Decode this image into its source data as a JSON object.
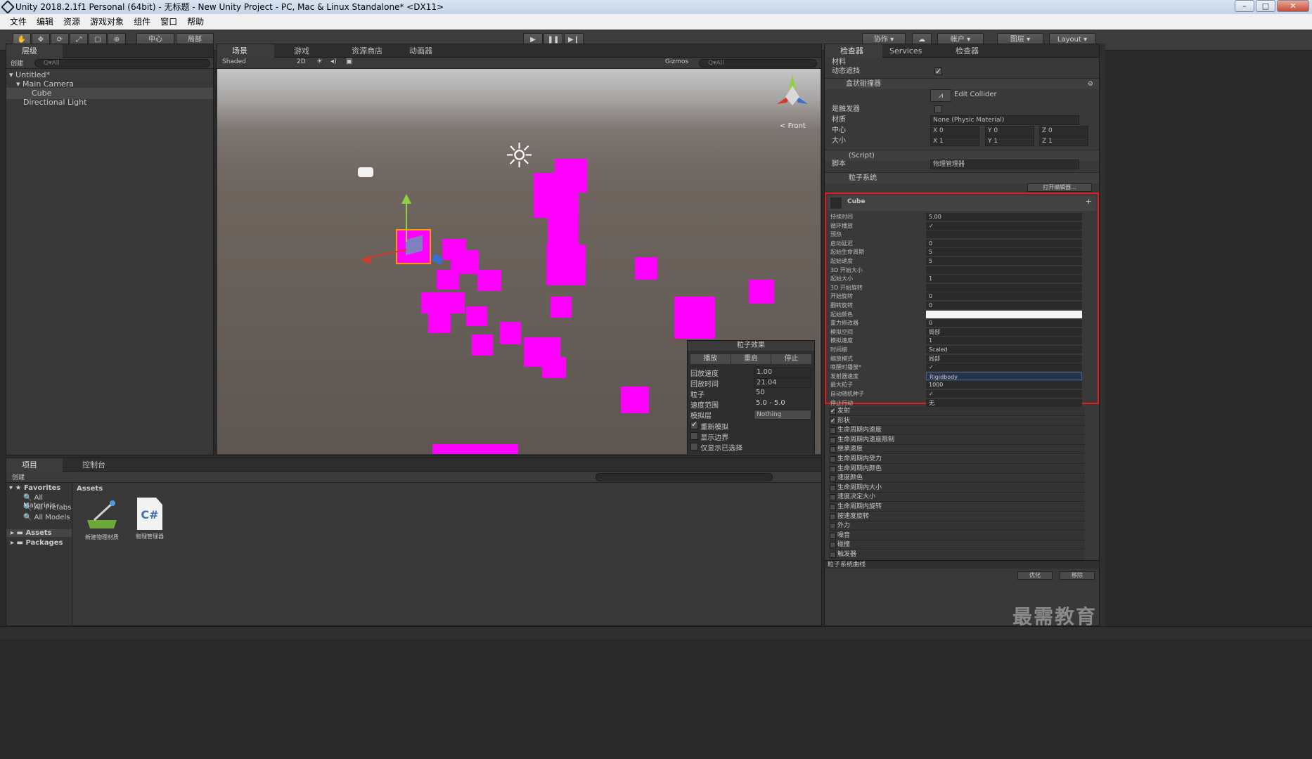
{
  "window": {
    "title": "Unity 2018.2.1f1 Personal (64bit) - 无标题 - New Unity Project - PC, Mac & Linux Standalone* <DX11>"
  },
  "menu": [
    "文件",
    "编辑",
    "资源",
    "游戏对象",
    "组件",
    "窗口",
    "帮助"
  ],
  "toolbar": {
    "pivot": "中心",
    "local": "局部",
    "collab": "协作",
    "account": "帐户",
    "layers": "图层",
    "layout": "Layout"
  },
  "hierarchy": {
    "tab": "层级",
    "create": "创建",
    "search": "Q▾All",
    "scene": "Untitled*",
    "items": [
      "Main Camera",
      "Cube",
      "Directional Light"
    ]
  },
  "scene_view": {
    "tabs": [
      "场景",
      "游戏",
      "资源商店",
      "动画器"
    ],
    "shading": "Shaded",
    "mode2d": "2D",
    "gizmos": "Gizmos",
    "search": "Q▾All",
    "orientation": "Front"
  },
  "particle_effect": {
    "title": "粒子效果",
    "play": "播放",
    "restart": "重启",
    "stop": "停止",
    "rows": [
      {
        "label": "回放速度",
        "value": "1.00"
      },
      {
        "label": "回放时间",
        "value": "21.04"
      },
      {
        "label": "粒子",
        "value": "50"
      },
      {
        "label": "速度范围",
        "value": "5.0 - 5.0"
      },
      {
        "label": "模拟层",
        "value": "Nothing"
      }
    ],
    "checks": [
      {
        "label": "重新模拟",
        "on": true
      },
      {
        "label": "显示边界",
        "on": false
      },
      {
        "label": "仅显示已选择",
        "on": false
      }
    ]
  },
  "project": {
    "tabs": [
      "项目",
      "控制台"
    ],
    "create": "创建",
    "favorites": "Favorites",
    "fav_items": [
      "All Materials",
      "All Prefabs",
      "All Models"
    ],
    "assets": "Assets",
    "packages": "Packages",
    "breadcrumb": "Assets",
    "asset_items": [
      {
        "name": "新建物理材质",
        "icon": "physic-material-icon"
      },
      {
        "name": "物理管理器",
        "icon": "csharp-script-icon",
        "glyph": "C#"
      }
    ]
  },
  "inspector": {
    "tabs": [
      "检查器",
      "Services",
      "检查器"
    ],
    "materials": "材料",
    "dynamic_occluded": "动态遮挡",
    "box_collider": {
      "title": "盒状碰撞器",
      "edit": "Edit Collider",
      "is_trigger": "是触发器",
      "material_label": "材质",
      "material": "None (Physic Material)",
      "center": "中心",
      "size": "大小",
      "center_vals": {
        "x": "0",
        "y": "0",
        "z": "0"
      },
      "size_vals": {
        "x": "1",
        "y": "1",
        "z": "1"
      }
    },
    "script": {
      "title": "(Script)",
      "label": "脚本",
      "value": "物理管理器"
    },
    "particle": {
      "title": "粒子系统",
      "open_editor": "打开编辑器...",
      "module": "Cube",
      "rows": [
        {
          "label": "持续时间",
          "value": "5.00"
        },
        {
          "label": "循环播放",
          "value": "✓"
        },
        {
          "label": "预热",
          "value": ""
        },
        {
          "label": "启动延迟",
          "value": "0"
        },
        {
          "label": "起始生命周期",
          "value": "5"
        },
        {
          "label": "起始速度",
          "value": "5"
        },
        {
          "label": "3D 开始大小",
          "value": ""
        },
        {
          "label": "起始大小",
          "value": "1"
        },
        {
          "label": "3D 开始旋转",
          "value": ""
        },
        {
          "label": "开始旋转",
          "value": "0"
        },
        {
          "label": "翻转旋转",
          "value": "0"
        },
        {
          "label": "起始颜色",
          "value": ""
        },
        {
          "label": "重力修改器",
          "value": "0"
        },
        {
          "label": "模拟空间",
          "value": "局部"
        },
        {
          "label": "模拟速度",
          "value": "1"
        },
        {
          "label": "时间缩",
          "value": "Scaled"
        },
        {
          "label": "缩放模式",
          "value": "局部"
        },
        {
          "label": "唤醒时播放*",
          "value": "✓"
        },
        {
          "label": "发射器速度",
          "value": "Rigidbody"
        },
        {
          "label": "最大粒子",
          "value": "1000"
        },
        {
          "label": "自动随机种子",
          "value": "✓"
        },
        {
          "label": "停止行动",
          "value": "无"
        }
      ],
      "modules": [
        {
          "label": "发射",
          "on": true
        },
        {
          "label": "形状",
          "on": true
        },
        {
          "label": "生命周期内速度",
          "on": false
        },
        {
          "label": "生命周期内速度限制",
          "on": false
        },
        {
          "label": "继承速度",
          "on": false
        },
        {
          "label": "生命周期内受力",
          "on": false
        },
        {
          "label": "生命周期内颜色",
          "on": false
        },
        {
          "label": "速度颜色",
          "on": false
        },
        {
          "label": "生命周期内大小",
          "on": false
        },
        {
          "label": "速度决定大小",
          "on": false
        },
        {
          "label": "生命周期内旋转",
          "on": false
        },
        {
          "label": "按速度旋转",
          "on": false
        },
        {
          "label": "外力",
          "on": false
        },
        {
          "label": "噪音",
          "on": false
        },
        {
          "label": "碰撞",
          "on": false
        },
        {
          "label": "触发器",
          "on": false
        }
      ],
      "curves": "粒子系统曲线",
      "optimize": "优化",
      "remove": "移除"
    }
  },
  "watermark": "最需教育",
  "colors": {
    "magenta": "#ff00ff",
    "highlight": "#e02020",
    "selection": "#3e5f96"
  }
}
